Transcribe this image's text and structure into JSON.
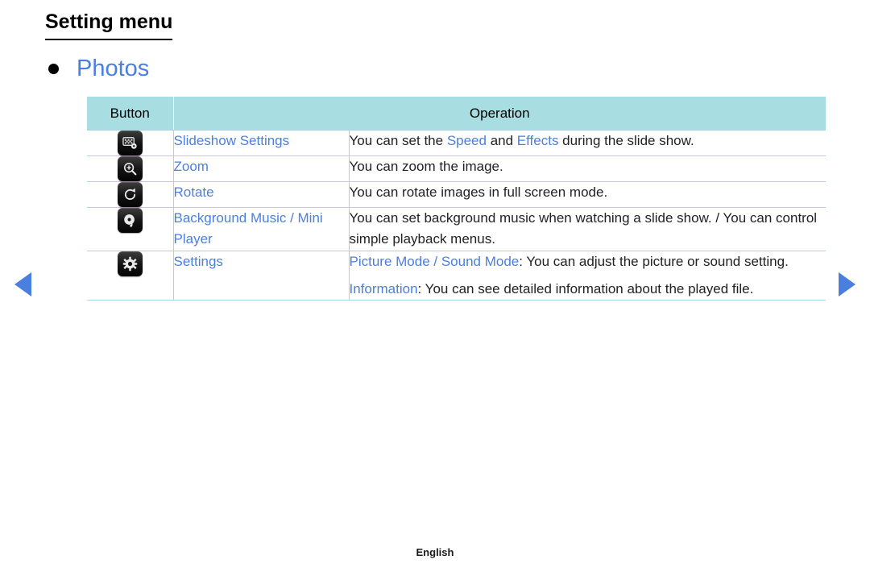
{
  "page": {
    "title": "Setting menu",
    "section_heading": "Photos",
    "footer_language": "English"
  },
  "colors": {
    "accent_blue": "#4a7fe0",
    "table_header_bg": "#a8dde2",
    "table_border": "#9fd9e0",
    "text": "#000000"
  },
  "nav": {
    "prev_label": "◀",
    "next_label": "▶"
  },
  "table": {
    "headers": {
      "button": "Button",
      "operation": "Operation"
    },
    "rows": [
      {
        "icon": "slideshow-settings-icon",
        "name": "Slideshow Settings",
        "desc_parts": [
          [
            {
              "t": "You can set the ",
              "hl": false
            },
            {
              "t": "Speed",
              "hl": true
            },
            {
              "t": " and ",
              "hl": false
            },
            {
              "t": "Effects",
              "hl": true
            },
            {
              "t": " during the slide show.",
              "hl": false
            }
          ]
        ]
      },
      {
        "icon": "zoom-icon",
        "name": "Zoom",
        "desc_parts": [
          [
            {
              "t": "You can zoom the image.",
              "hl": false
            }
          ]
        ]
      },
      {
        "icon": "rotate-icon",
        "name": "Rotate",
        "desc_parts": [
          [
            {
              "t": "You can rotate images in full screen mode.",
              "hl": false
            }
          ]
        ]
      },
      {
        "icon": "background-music-icon",
        "name": "Background Music / Mini Player",
        "desc_parts": [
          [
            {
              "t": "You can set background music when watching a slide show. / You can control simple playback menus.",
              "hl": false
            }
          ]
        ]
      },
      {
        "icon": "settings-gear-icon",
        "name": "Settings",
        "desc_parts": [
          [
            {
              "t": "Picture Mode / Sound Mode",
              "hl": true
            },
            {
              "t": ": You can adjust the picture or sound setting.",
              "hl": false
            }
          ],
          [
            {
              "t": "Information",
              "hl": true
            },
            {
              "t": ": You can see detailed information about the played file.",
              "hl": false
            }
          ]
        ]
      }
    ]
  }
}
